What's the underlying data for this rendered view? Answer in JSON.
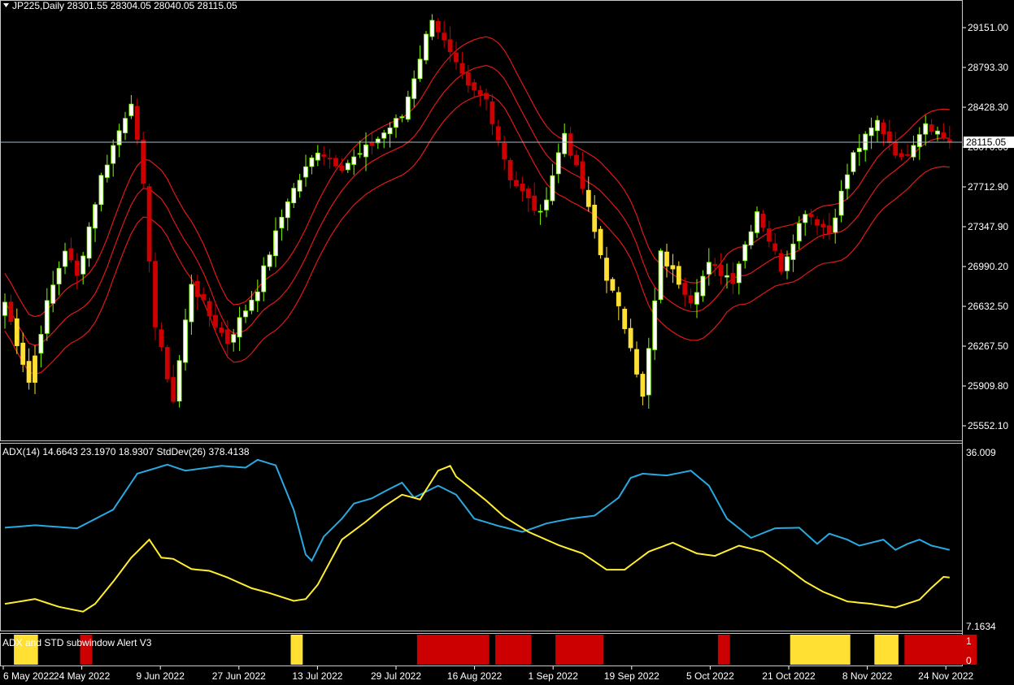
{
  "colors": {
    "background": "#000000",
    "bull_candle": "#ffffff",
    "bull_border": "#7cfc00",
    "bear_candle": "#cc0000",
    "alert_candle": "#ffe033",
    "envelope": "#e01818",
    "adx_line": "#29a9e0",
    "std_line": "#ffee30",
    "price_line": "#a8b8c8",
    "axis": "#ffffff",
    "alert_red": "#cc0000",
    "alert_yellow": "#ffe033"
  },
  "main_panel": {
    "header": "JP225,Daily  28301.55 28304.05 28040.05 28115.05",
    "header_icon": "triangle-down-icon",
    "price_ticks": [
      "29151.00",
      "28793.30",
      "28428.30",
      "28070.00",
      "27712.90",
      "27347.90",
      "26990.20",
      "26632.50",
      "26267.50",
      "25909.80",
      "25552.10"
    ],
    "current_price_label": "28115.05",
    "current_price": 28115.05
  },
  "adx_panel": {
    "header": "ADX(14) 14.6643 23.1970 18.9307  StdDev(26) 378.4138",
    "ticks": [
      "36.009",
      "7.1634"
    ]
  },
  "alert_panel": {
    "header": "ADX and STD subwindow Alert V3",
    "ticks": [
      "1",
      "0"
    ]
  },
  "x_axis": {
    "labels": [
      "6 May 2022",
      "24 May 2022",
      "9 Jun 2022",
      "27 Jun 2022",
      "13 Jul 2022",
      "29 Jul 2022",
      "16 Aug 2022",
      "1 Sep 2022",
      "19 Sep 2022",
      "5 Oct 2022",
      "21 Oct 2022",
      "8 Nov 2022",
      "24 Nov 2022"
    ]
  },
  "chart_data": [
    {
      "type": "candlestick",
      "title": "JP225,Daily",
      "ylim": [
        25400,
        29420
      ],
      "price_keypoints": [
        [
          0,
          26670
        ],
        [
          4,
          25950
        ],
        [
          7,
          26650
        ],
        [
          10,
          27150
        ],
        [
          12,
          26900
        ],
        [
          16,
          27800
        ],
        [
          21,
          28500
        ],
        [
          23,
          27700
        ],
        [
          25,
          26450
        ],
        [
          28,
          25780
        ],
        [
          31,
          26850
        ],
        [
          34,
          26550
        ],
        [
          37,
          26310
        ],
        [
          42,
          26800
        ],
        [
          47,
          27600
        ],
        [
          52,
          28050
        ],
        [
          56,
          27900
        ],
        [
          59,
          28000
        ],
        [
          66,
          28350
        ],
        [
          71,
          29250
        ],
        [
          74,
          28900
        ],
        [
          77,
          28600
        ],
        [
          80,
          28500
        ],
        [
          84,
          27800
        ],
        [
          89,
          27450
        ],
        [
          93,
          28200
        ],
        [
          96,
          27700
        ],
        [
          100,
          26900
        ],
        [
          104,
          26300
        ],
        [
          106,
          25800
        ],
        [
          109,
          27100
        ],
        [
          114,
          26700
        ],
        [
          117,
          27000
        ],
        [
          121,
          26880
        ],
        [
          125,
          27500
        ],
        [
          129,
          26980
        ],
        [
          133,
          27500
        ],
        [
          137,
          27300
        ],
        [
          141,
          28000
        ],
        [
          145,
          28300
        ],
        [
          149,
          27950
        ],
        [
          153,
          28300
        ],
        [
          157,
          28115
        ]
      ],
      "alert_candle_ranges": [
        [
          2,
          5
        ],
        [
          97,
          106
        ],
        [
          110,
          112
        ]
      ]
    },
    {
      "type": "line",
      "series": [
        {
          "name": "ADX(14)",
          "keypoints": [
            [
              0,
              23.5
            ],
            [
              5,
              23.9
            ],
            [
              12,
              23.4
            ],
            [
              18,
              26.5
            ],
            [
              22,
              32.5
            ],
            [
              27,
              34
            ],
            [
              30,
              33
            ],
            [
              36,
              33.8
            ],
            [
              40,
              33.5
            ],
            [
              42,
              34.8
            ],
            [
              45,
              33.9
            ],
            [
              48,
              26.5
            ],
            [
              50,
              19
            ],
            [
              51,
              18
            ],
            [
              53,
              22
            ],
            [
              56,
              25
            ],
            [
              58,
              27.5
            ],
            [
              61,
              28.4
            ],
            [
              64,
              30
            ],
            [
              66,
              31
            ],
            [
              68,
              28.5
            ],
            [
              72,
              30.5
            ],
            [
              75,
              29
            ],
            [
              78,
              25
            ],
            [
              82,
              23.8
            ],
            [
              86,
              22.8
            ],
            [
              90,
              24.2
            ],
            [
              94,
              25
            ],
            [
              98,
              25.5
            ],
            [
              102,
              28.5
            ],
            [
              104,
              31.8
            ],
            [
              106,
              32.5
            ],
            [
              110,
              32.2
            ],
            [
              114,
              33
            ],
            [
              117,
              30.5
            ],
            [
              120,
              25
            ],
            [
              124,
              21.8
            ],
            [
              128,
              23.4
            ],
            [
              132,
              23.5
            ],
            [
              135,
              20.8
            ],
            [
              137,
              22.5
            ],
            [
              140,
              21.5
            ],
            [
              142,
              20.5
            ],
            [
              144,
              21
            ],
            [
              146,
              21.5
            ],
            [
              148,
              19.8
            ],
            [
              150,
              20.8
            ],
            [
              152,
              21.5
            ],
            [
              154,
              20.5
            ],
            [
              157,
              19.8
            ]
          ]
        },
        {
          "name": "StdDev(26)",
          "keypoints": [
            [
              0,
              10.8
            ],
            [
              5,
              11.6
            ],
            [
              9,
              10.3
            ],
            [
              13,
              9.5
            ],
            [
              15,
              10.8
            ],
            [
              18,
              14.5
            ],
            [
              21,
              18.5
            ],
            [
              24,
              21.5
            ],
            [
              26,
              18.5
            ],
            [
              28,
              18.3
            ],
            [
              31,
              16.6
            ],
            [
              34,
              16.3
            ],
            [
              37,
              15.2
            ],
            [
              41,
              13.4
            ],
            [
              44,
              12.6
            ],
            [
              48,
              11.3
            ],
            [
              50,
              11.6
            ],
            [
              52,
              14
            ],
            [
              56,
              21.5
            ],
            [
              60,
              24.5
            ],
            [
              63,
              27
            ],
            [
              66,
              29
            ],
            [
              69,
              28.2
            ],
            [
              72,
              33
            ],
            [
              74,
              33.8
            ],
            [
              75,
              32
            ],
            [
              80,
              28
            ],
            [
              83,
              25.3
            ],
            [
              87,
              22.8
            ],
            [
              92,
              20.6
            ],
            [
              96,
              19.2
            ],
            [
              100,
              16.5
            ],
            [
              103,
              16.5
            ],
            [
              107,
              19.5
            ],
            [
              111,
              21
            ],
            [
              115,
              19.2
            ],
            [
              118,
              18.8
            ],
            [
              122,
              20.5
            ],
            [
              126,
              19.5
            ],
            [
              129,
              17.5
            ],
            [
              133,
              14.5
            ],
            [
              136,
              12.8
            ],
            [
              140,
              11.2
            ],
            [
              144,
              10.8
            ],
            [
              148,
              10.2
            ],
            [
              152,
              11.5
            ],
            [
              154,
              13.5
            ],
            [
              156,
              15.3
            ],
            [
              157,
              15.2
            ]
          ]
        }
      ],
      "ylim": [
        7.1634,
        36.009
      ]
    },
    {
      "type": "bar",
      "series": [
        {
          "name": "ADX and STD subwindow Alert V3",
          "red_ranges": [
            [
              13,
              14
            ],
            [
              69,
              80
            ],
            [
              82,
              87
            ],
            [
              92,
              99
            ],
            [
              119,
              120
            ],
            [
              146,
              147
            ],
            [
              150,
              161
            ]
          ],
          "yellow_ranges": [
            [
              2,
              5
            ],
            [
              48,
              49
            ],
            [
              131,
              140
            ],
            [
              145,
              148
            ]
          ]
        }
      ],
      "ylim": [
        0,
        1
      ]
    }
  ]
}
